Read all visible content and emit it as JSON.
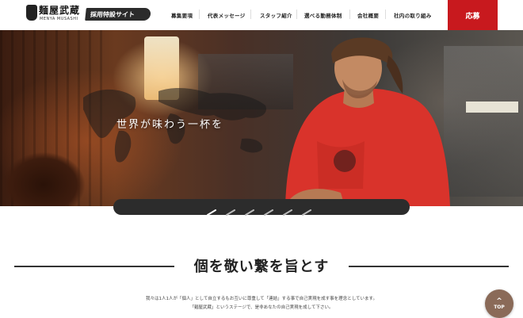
{
  "header": {
    "logo_title": "麺屋武蔵",
    "logo_sub": "MENYA MUSASHI",
    "recruit_badge": "採用特設サイト",
    "nav": [
      {
        "label": "募集要項"
      },
      {
        "label": "代表メッセージ"
      },
      {
        "label": "スタッフ紹介"
      },
      {
        "label": "選べる勤務体制"
      },
      {
        "label": "会社概要"
      },
      {
        "label": "社内の取り組み"
      }
    ],
    "apply_label": "応募"
  },
  "hero": {
    "copy": "世界が味わう一杯を",
    "slide_count": 6,
    "active_slide": 1
  },
  "section": {
    "title": "個を敬い繋を旨とす",
    "line1": "我々は1人1人が「個人」として自立するもお互いに尊重して「連結」する事で自己実現を成す事を理念としています。",
    "line2": "「麺屋武蔵」というステージで、是非あなたの自己実現を成して下さい。"
  },
  "top_button": {
    "label": "TOP",
    "icon": "chevron-up-icon"
  },
  "colors": {
    "accent": "#c8191e",
    "header_bg": "#ffffff",
    "badge_bg": "#2b2b2b",
    "top_btn_bg": "#8a6a58"
  }
}
